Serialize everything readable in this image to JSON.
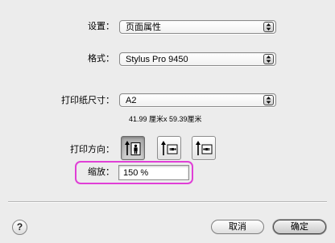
{
  "dialog": {
    "settings": {
      "label": "设置：",
      "value": "页面属性"
    },
    "format": {
      "label": "格式：",
      "value": "Stylus Pro 9450"
    },
    "paper_size": {
      "label": "打印纸尺寸：",
      "value": "A2",
      "dimensions": "41.99 厘米x 59.39厘米"
    },
    "orientation": {
      "label": "打印方向：",
      "options": [
        {
          "icon": "portrait-icon",
          "selected": true
        },
        {
          "icon": "landscape-icon",
          "selected": false
        },
        {
          "icon": "reverse-landscape-icon",
          "selected": false
        }
      ]
    },
    "scale": {
      "label": "缩放：",
      "value": "150 %"
    },
    "help_label": "?",
    "cancel_label": "取消",
    "ok_label": "确定"
  },
  "icons": {
    "popup_arrow": "up-down-arrows-icon",
    "help": "help-icon"
  },
  "colors": {
    "highlight": "#e03fd6",
    "background": "#ececec"
  }
}
